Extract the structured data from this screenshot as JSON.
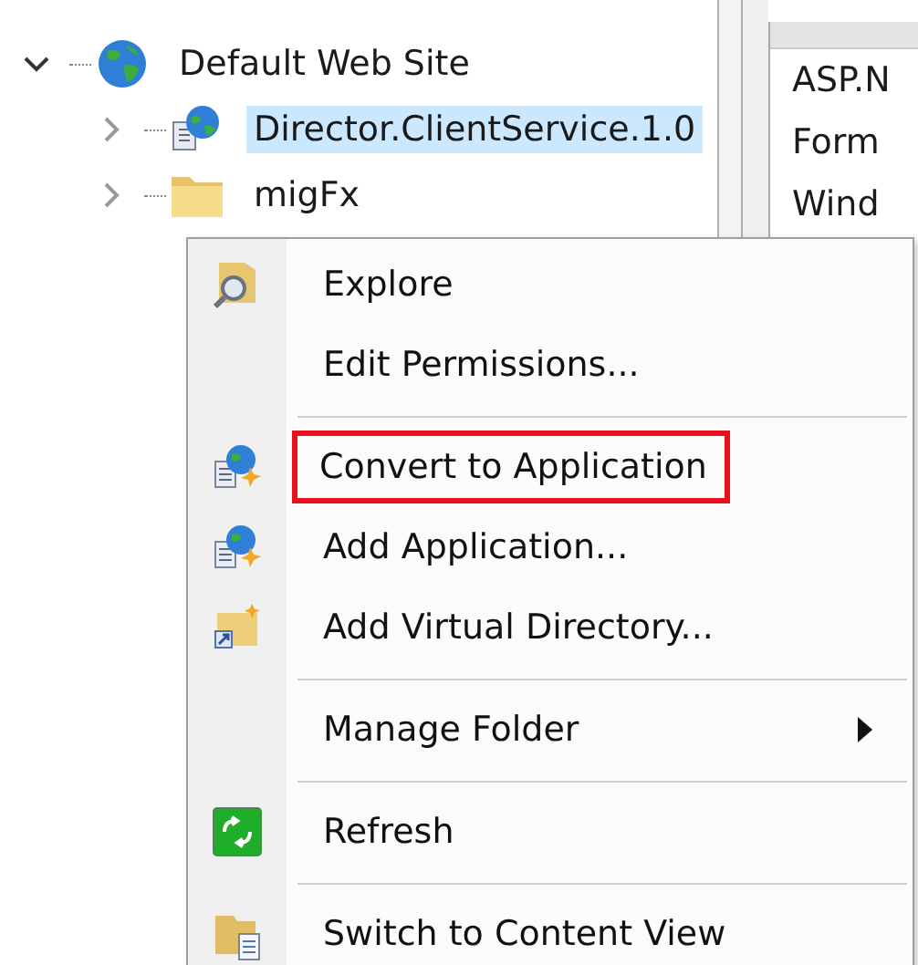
{
  "tree": [
    {
      "label": "Default Web Site",
      "expanded": true,
      "selected": false,
      "children": [
        {
          "label": "Director.ClientService.1.0",
          "expanded": false,
          "selected": true
        },
        {
          "label": "migFx",
          "expanded": false,
          "selected": false
        }
      ]
    }
  ],
  "features_list": {
    "items": [
      "ASP.N",
      "Form",
      "Wind"
    ]
  },
  "context_menu": {
    "items": [
      {
        "kind": "item",
        "label": "Explore",
        "highlighted": false,
        "submenu": false
      },
      {
        "kind": "item",
        "label": "Edit Permissions...",
        "highlighted": false,
        "submenu": false
      },
      {
        "kind": "separator"
      },
      {
        "kind": "item",
        "label": "Convert to Application",
        "highlighted": true,
        "submenu": false
      },
      {
        "kind": "item",
        "label": "Add Application...",
        "highlighted": false,
        "submenu": false
      },
      {
        "kind": "item",
        "label": "Add Virtual Directory...",
        "highlighted": false,
        "submenu": false
      },
      {
        "kind": "separator"
      },
      {
        "kind": "item",
        "label": "Manage Folder",
        "highlighted": false,
        "submenu": true
      },
      {
        "kind": "separator"
      },
      {
        "kind": "item",
        "label": "Refresh",
        "highlighted": false,
        "submenu": false
      },
      {
        "kind": "separator"
      },
      {
        "kind": "item",
        "label": "Switch to Content View",
        "highlighted": false,
        "submenu": false
      }
    ]
  }
}
